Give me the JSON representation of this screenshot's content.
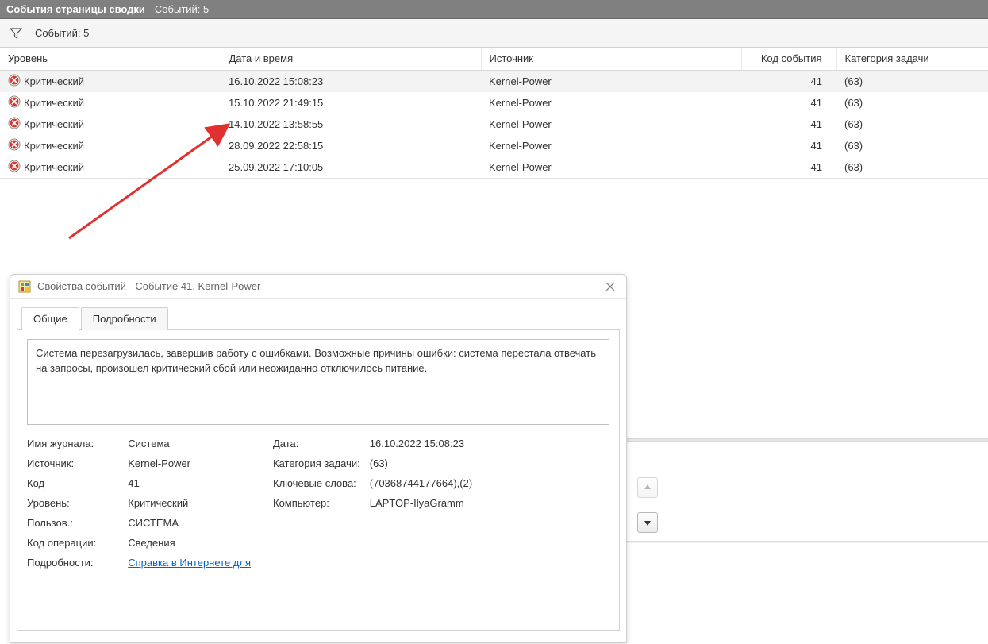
{
  "header": {
    "title": "События страницы сводки",
    "count_label": "Событий: 5"
  },
  "toolbar": {
    "count_label": "Событий: 5"
  },
  "table": {
    "columns": {
      "level": "Уровень",
      "datetime": "Дата и время",
      "source": "Источник",
      "event_id": "Код события",
      "task_category": "Категория задачи"
    },
    "rows": [
      {
        "level": "Критический",
        "datetime": "16.10.2022 15:08:23",
        "source": "Kernel-Power",
        "event_id": "41",
        "task_category": "(63)",
        "selected": true
      },
      {
        "level": "Критический",
        "datetime": "15.10.2022 21:49:15",
        "source": "Kernel-Power",
        "event_id": "41",
        "task_category": "(63)",
        "selected": false
      },
      {
        "level": "Критический",
        "datetime": "14.10.2022 13:58:55",
        "source": "Kernel-Power",
        "event_id": "41",
        "task_category": "(63)",
        "selected": false
      },
      {
        "level": "Критический",
        "datetime": "28.09.2022 22:58:15",
        "source": "Kernel-Power",
        "event_id": "41",
        "task_category": "(63)",
        "selected": false
      },
      {
        "level": "Критический",
        "datetime": "25.09.2022 17:10:05",
        "source": "Kernel-Power",
        "event_id": "41",
        "task_category": "(63)",
        "selected": false
      }
    ]
  },
  "dialog": {
    "title": "Свойства событий - Событие 41, Kernel-Power",
    "tabs": {
      "general": "Общие",
      "details": "Подробности"
    },
    "description": "Система перезагрузилась, завершив работу с ошибками. Возможные причины ошибки: система перестала отвечать на запросы, произошел критический сбой или неожиданно отключилось питание.",
    "fields": {
      "log_name_label": "Имя журнала:",
      "log_name": "Система",
      "source_label": "Источник:",
      "source": "Kernel-Power",
      "event_id_label": "Код",
      "event_id": "41",
      "level_label": "Уровень:",
      "level": "Критический",
      "user_label": "Пользов.:",
      "user": "СИСТЕМА",
      "opcode_label": "Код операции:",
      "opcode": "Сведения",
      "moreinfo_label": "Подробности:",
      "moreinfo_link": "Справка в Интернете для ",
      "date_label": "Дата:",
      "date": "16.10.2022 15:08:23",
      "task_label": "Категория задачи:",
      "task": "(63)",
      "keywords_label": "Ключевые слова:",
      "keywords": "(70368744177664),(2)",
      "computer_label": "Компьютер:",
      "computer": "LAPTOP-IlyaGramm"
    }
  }
}
